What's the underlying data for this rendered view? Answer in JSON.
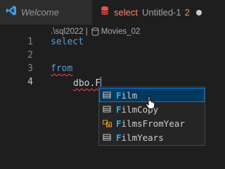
{
  "tabs": [
    {
      "label": "Welcome",
      "icon": "vscode-logo-icon",
      "active": false
    },
    {
      "label": "select",
      "subtitle": "Untitled-1",
      "problems": "2",
      "icon": "database-icon",
      "active": true,
      "dirty": true
    }
  ],
  "breadcrumb": {
    "server": ".\\sql2022",
    "separator": "|",
    "database": "Movies_02",
    "database_icon": "database-icon"
  },
  "editor": {
    "lines": [
      {
        "number": "1",
        "text": "select"
      },
      {
        "number": "2",
        "text": ""
      },
      {
        "number": "3",
        "text": "from"
      },
      {
        "number": "4",
        "text": "dbo.F"
      }
    ]
  },
  "suggestions": {
    "match_prefix": "F",
    "items": [
      {
        "label": "Film",
        "match": "F",
        "rest": "ilm",
        "icon": "table-icon",
        "selected": true
      },
      {
        "label": "FilmCopy",
        "match": "F",
        "rest": "ilmCopy",
        "icon": "table-icon",
        "selected": false
      },
      {
        "label": "FilmsFromYear",
        "match": "F",
        "rest": "ilmsFromYear",
        "icon": "function-icon",
        "selected": false
      },
      {
        "label": "FilmYears",
        "match": "F",
        "rest": "ilmYears",
        "icon": "table-icon",
        "selected": false
      }
    ]
  },
  "colors": {
    "accent": "#0078d4",
    "keyword": "#569cd6",
    "error": "#f48771",
    "match": "#2aaaff"
  }
}
